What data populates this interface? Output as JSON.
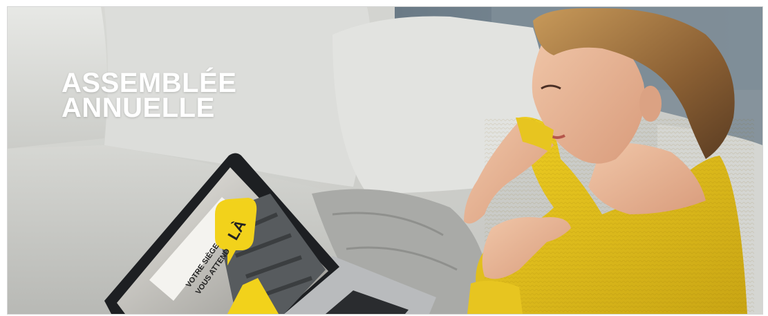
{
  "headline": {
    "line1": "ASSEMBLÉE",
    "line2": "ANNUELLE"
  },
  "laptop_screen": {
    "tagline_line1": "VOTRE SIÈGE",
    "tagline_line2": "VOUS ATTEND",
    "bubble_text": "LÀ"
  },
  "colors": {
    "accent_yellow": "#f2d21b",
    "sweater_yellow": "#e5c31c",
    "sofa_grey": "#d2d3cf",
    "text_white": "#ffffff"
  }
}
